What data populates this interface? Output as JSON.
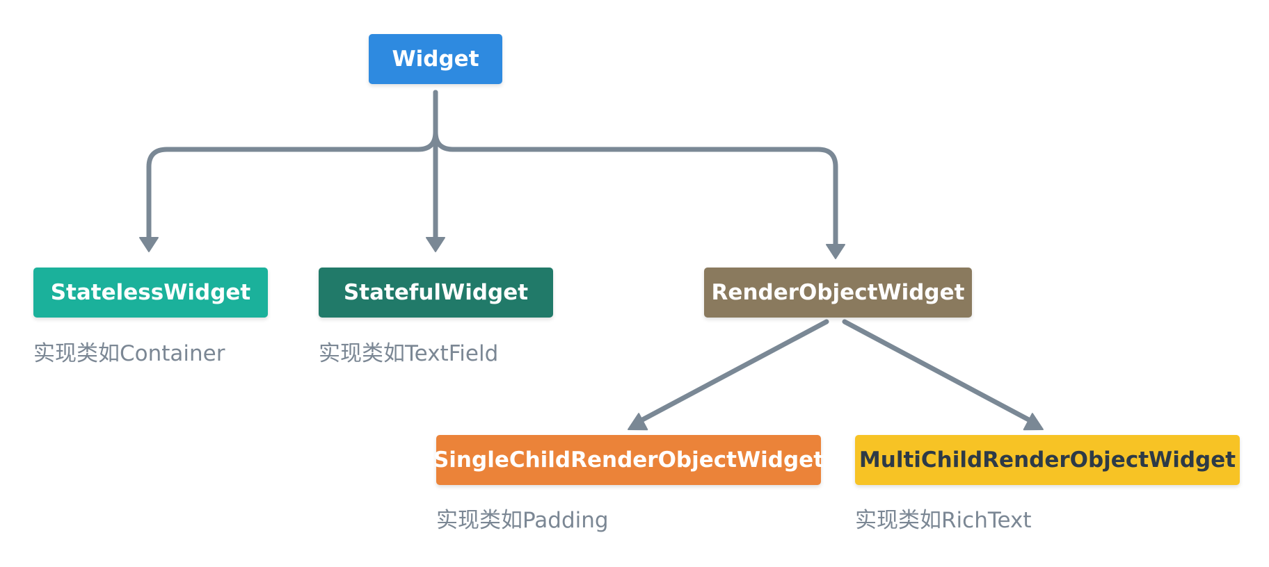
{
  "colors": {
    "edge": "#7a8895",
    "caption": "#7b8794"
  },
  "nodes": {
    "widget": {
      "label": "Widget",
      "bg": "#2e8ae0",
      "fg": "#ffffff"
    },
    "stateless": {
      "label": "StatelessWidget",
      "bg": "#1bb19b",
      "fg": "#ffffff",
      "caption": "实现类如Container"
    },
    "stateful": {
      "label": "StatefulWidget",
      "bg": "#217a69",
      "fg": "#ffffff",
      "caption": "实现类如TextField"
    },
    "render": {
      "label": "RenderObjectWidget",
      "bg": "#8a7a5e",
      "fg": "#ffffff"
    },
    "single": {
      "label": "SingleChildRenderObjectWidget",
      "bg": "#eb8339",
      "fg": "#ffffff",
      "caption": "实现类如Padding"
    },
    "multi": {
      "label": "MultiChildRenderObjectWidget",
      "bg": "#f7c325",
      "fg": "#2d3a47",
      "caption": "实现类如RichText"
    }
  },
  "edges": [
    {
      "from": "widget",
      "to": "stateless"
    },
    {
      "from": "widget",
      "to": "stateful"
    },
    {
      "from": "widget",
      "to": "render"
    },
    {
      "from": "render",
      "to": "single"
    },
    {
      "from": "render",
      "to": "multi"
    }
  ]
}
